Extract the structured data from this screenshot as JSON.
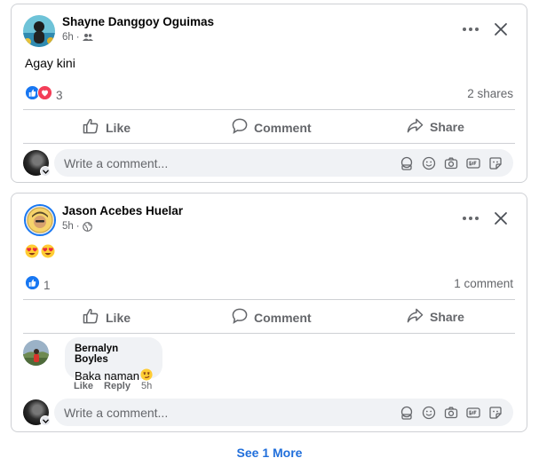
{
  "posts": [
    {
      "author": "Shayne Danggoy Oguimas",
      "time": "6h",
      "separator": "·",
      "audience_icon": "friends-icon",
      "text": "Agay kini",
      "reaction_icons": [
        "like-icon",
        "love-icon"
      ],
      "reaction_count": "3",
      "stats_right": "2 shares",
      "actions": {
        "like": "Like",
        "comment": "Comment",
        "share": "Share"
      },
      "comment_placeholder": "Write a comment..."
    },
    {
      "author": "Jason Acebes Huelar",
      "time": "5h",
      "separator": "·",
      "audience_icon": "globe-icon",
      "emoji_text": [
        "heart-eyes-emoji",
        "heart-eyes-emoji"
      ],
      "reaction_icons": [
        "like-icon"
      ],
      "reaction_count": "1",
      "stats_right": "1 comment",
      "actions": {
        "like": "Like",
        "comment": "Comment",
        "share": "Share"
      },
      "reply": {
        "author": "Bernalyn Boyles",
        "text": "Baka naman",
        "emoji": "smirk-emoji",
        "like_label": "Like",
        "reply_label": "Reply",
        "time": "5h"
      },
      "comment_placeholder": "Write a comment..."
    }
  ],
  "see_more": "See 1 More",
  "colors": {
    "accent": "#216fdb",
    "like_blue": "#1877f2",
    "love_red": "#f33e58",
    "muted_text": "#65676b",
    "input_bg": "#f0f2f5",
    "border": "#ced0d4"
  }
}
